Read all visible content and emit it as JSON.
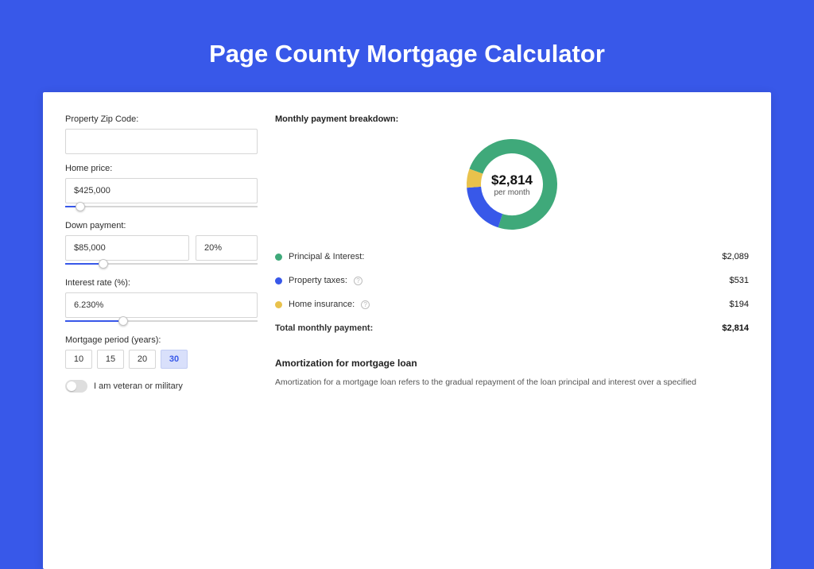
{
  "title": "Page County Mortgage Calculator",
  "form": {
    "zip_label": "Property Zip Code:",
    "zip_value": "",
    "home_price_label": "Home price:",
    "home_price_value": "$425,000",
    "home_price_slider_pct": 8,
    "down_payment_label": "Down payment:",
    "down_payment_value": "$85,000",
    "down_payment_pct_value": "20%",
    "down_payment_slider_pct": 20,
    "interest_label": "Interest rate (%):",
    "interest_value": "6.230%",
    "interest_slider_pct": 30,
    "period_label": "Mortgage period (years):",
    "periods": [
      "10",
      "15",
      "20",
      "30"
    ],
    "period_selected_index": 3,
    "veteran_label": "I am veteran or military",
    "veteran_on": false
  },
  "breakdown": {
    "title": "Monthly payment breakdown:",
    "center_amount": "$2,814",
    "center_sub": "per month",
    "rows": [
      {
        "color": "green",
        "label": "Principal & Interest:",
        "value": "$2,089",
        "info": false,
        "num": 2089
      },
      {
        "color": "blue",
        "label": "Property taxes:",
        "value": "$531",
        "info": true,
        "num": 531
      },
      {
        "color": "yellow",
        "label": "Home insurance:",
        "value": "$194",
        "info": true,
        "num": 194
      }
    ],
    "total_label": "Total monthly payment:",
    "total_value": "$2,814",
    "total_num": 2814
  },
  "amort": {
    "title": "Amortization for mortgage loan",
    "text": "Amortization for a mortgage loan refers to the gradual repayment of the loan principal and interest over a specified"
  },
  "chart_data": {
    "type": "pie",
    "title": "Monthly payment breakdown",
    "categories": [
      "Principal & Interest",
      "Property taxes",
      "Home insurance"
    ],
    "values": [
      2089,
      531,
      194
    ],
    "colors": [
      "#3fa97a",
      "#3858e9",
      "#e9c24c"
    ]
  }
}
